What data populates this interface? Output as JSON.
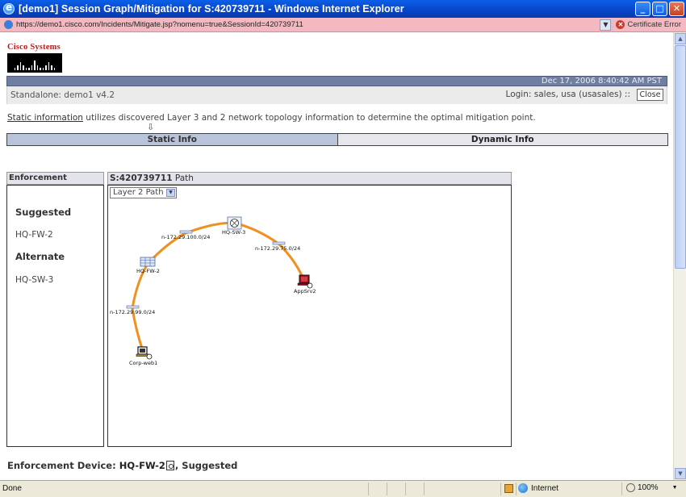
{
  "window": {
    "title": "[demo1] Session Graph/Mitigation for S:420739711 - Windows Internet Explorer",
    "buttons": {
      "minimize": "_",
      "maximize": "□",
      "close": "✕"
    }
  },
  "addressbar": {
    "url": "https://demo1.cisco.com/Incidents/Mitigate.jsp?nomenu=true&SessionId=420739711",
    "cert_error": "Certificate Error"
  },
  "logo": {
    "brand": "Cisco Systems"
  },
  "header": {
    "datetime": "Dec 17, 2006 8:40:42 AM PST",
    "standalone": "Standalone: demo1 v4.2",
    "login": "Login: sales, usa (usasales)  ::",
    "close_label": "Close"
  },
  "info": {
    "link": "Static information",
    "text": " utilizes discovered Layer 3 and 2 network topology information to determine the optimal mitigation point."
  },
  "tabs": [
    {
      "label": "Static Info",
      "active": true
    },
    {
      "label": "Dynamic Info",
      "active": false
    }
  ],
  "enforcement_panel": {
    "title": "Enforcement Devices",
    "suggested_label": "Suggested",
    "suggested": [
      "HQ-FW-2"
    ],
    "alternate_label": "Alternate",
    "alternate": [
      "HQ-SW-3"
    ]
  },
  "path_panel": {
    "session_id": "S:420739711",
    "suffix": " Path",
    "select_value": "Layer 2 Path",
    "nodes": {
      "corp_web1": "Corp-web1",
      "net_99": "n-172.29.99.0/24",
      "hq_fw2": "HQ-FW-2",
      "net_100": "n-172.29.100.0/24",
      "hq_sw3": "HQ-SW-3",
      "net_75": "n-172.29.75.0/24",
      "appsrv2": "AppSrv2"
    },
    "link_color": "#f0901e"
  },
  "enforcement_device": {
    "label": "Enforcement Device:",
    "device": "HQ-FW-2",
    "status": ", Suggested"
  },
  "statusbar": {
    "status": "Done",
    "zone": "Internet",
    "zoom": "100%"
  }
}
